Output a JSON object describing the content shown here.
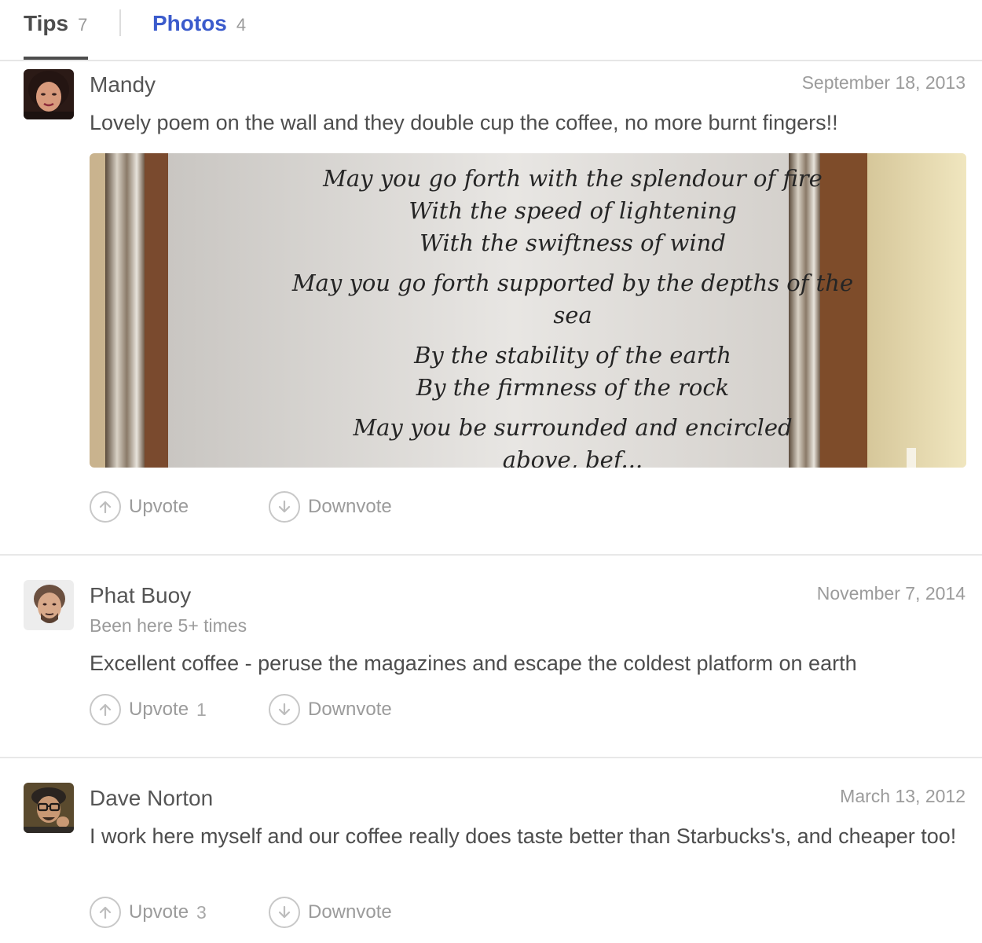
{
  "tabs": [
    {
      "label": "Tips",
      "count": "7"
    },
    {
      "label": "Photos",
      "count": "4"
    }
  ],
  "colors": {
    "accent": "#3b5bcc",
    "text": "#4d4d4d",
    "muted": "#9b9b9b",
    "divider": "#e8e8e8"
  },
  "tips": [
    {
      "author": "Mandy",
      "date": "September 18, 2013",
      "text": "Lovely poem on the wall and they double cup the coffee, no more burnt fingers!!",
      "photo": {
        "lines": [
          "May you go forth with the splendour of fire",
          "With the speed of lightening",
          "With the swiftness of wind",
          "May you go forth supported by the depths of the",
          "sea",
          "By the stability of the earth",
          "By the firmness of the rock",
          "May you be surrounded and encircled",
          "above, bef..."
        ]
      },
      "upvote_label": "Upvote",
      "downvote_label": "Downvote"
    },
    {
      "author": "Phat Buoy",
      "subline": "Been here 5+ times",
      "date": "November 7, 2014",
      "text": "Excellent coffee - peruse the magazines and escape the coldest platform on earth",
      "upvote_label": "Upvote",
      "upvote_count": "1",
      "downvote_label": "Downvote"
    },
    {
      "author": "Dave Norton",
      "date": "March 13, 2012",
      "text": "I work here myself and our coffee really does taste better than Starbucks's, and cheaper too!",
      "upvote_label": "Upvote",
      "upvote_count": "3",
      "downvote_label": "Downvote"
    }
  ],
  "icons": {
    "upvote": "arrow-up-circle-icon",
    "downvote": "arrow-down-circle-icon"
  }
}
